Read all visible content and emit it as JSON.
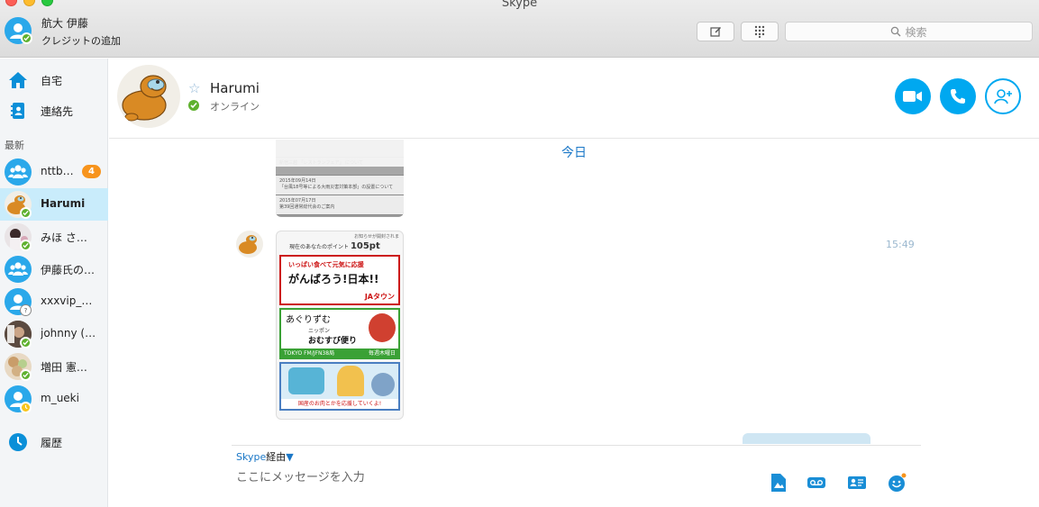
{
  "window": {
    "title": "Skype"
  },
  "me": {
    "name": "航大 伊藤",
    "subtitle": "クレジットの追加"
  },
  "search": {
    "placeholder": "検索"
  },
  "sidebar": {
    "nav": [
      {
        "label": "自宅",
        "icon": "home-icon"
      },
      {
        "label": "連絡先",
        "icon": "contacts-icon"
      }
    ],
    "recent_label": "最新",
    "contacts": [
      {
        "name": "nttb…",
        "badge": "4",
        "type": "group"
      },
      {
        "name": "Harumi",
        "status": "online",
        "selected": true
      },
      {
        "name": "みほ さ…",
        "status": "online"
      },
      {
        "name": "伊藤氏の…",
        "type": "group"
      },
      {
        "name": "xxxvip_…",
        "status": "unknown"
      },
      {
        "name": "johnny (…",
        "status": "online"
      },
      {
        "name": "増田 憲…",
        "status": "online"
      },
      {
        "name": "m_ueki",
        "status": "away"
      }
    ],
    "history_label": "履歴"
  },
  "conversation": {
    "name": "Harumi",
    "status_text": "オンライン",
    "date_divider": "今日",
    "messages": [
      {
        "kind": "image",
        "caption_lines": [
          "新宿三越 「レストランフェア」 について",
          "2015年09月14日",
          "「台風18号等による大雨災害対策本部」の設置について",
          "2015年07月17日",
          "第39回通常総代会のご案内"
        ]
      },
      {
        "kind": "image",
        "time": "15:49",
        "points_text": "現在のあなたのポイント",
        "points_value": "105pt",
        "notice": "お知らせが開封されま",
        "banners": [
          {
            "line1": "いっぱい食べて元気に応援",
            "line2": "がんばろう!日本!!",
            "brand": "JAタウン"
          },
          {
            "line1": "あぐりずむ",
            "line2": "おむすび便り",
            "sub": "ニッポン",
            "footer": "TOKYO FM/JFN38局",
            "footer2": "毎週木曜日"
          },
          {
            "line1": "国産のお肉とかを応援していくよ!"
          }
        ]
      }
    ]
  },
  "composer": {
    "via_prefix": "Skype",
    "via_suffix": "経由",
    "placeholder": "ここにメッセージを入力"
  },
  "colors": {
    "accent": "#00a8f0",
    "online": "#5fb12f",
    "away": "#f8c51b",
    "badge": "#f7941d",
    "selected_row": "#c9ecfb",
    "link": "#1a77c7"
  }
}
